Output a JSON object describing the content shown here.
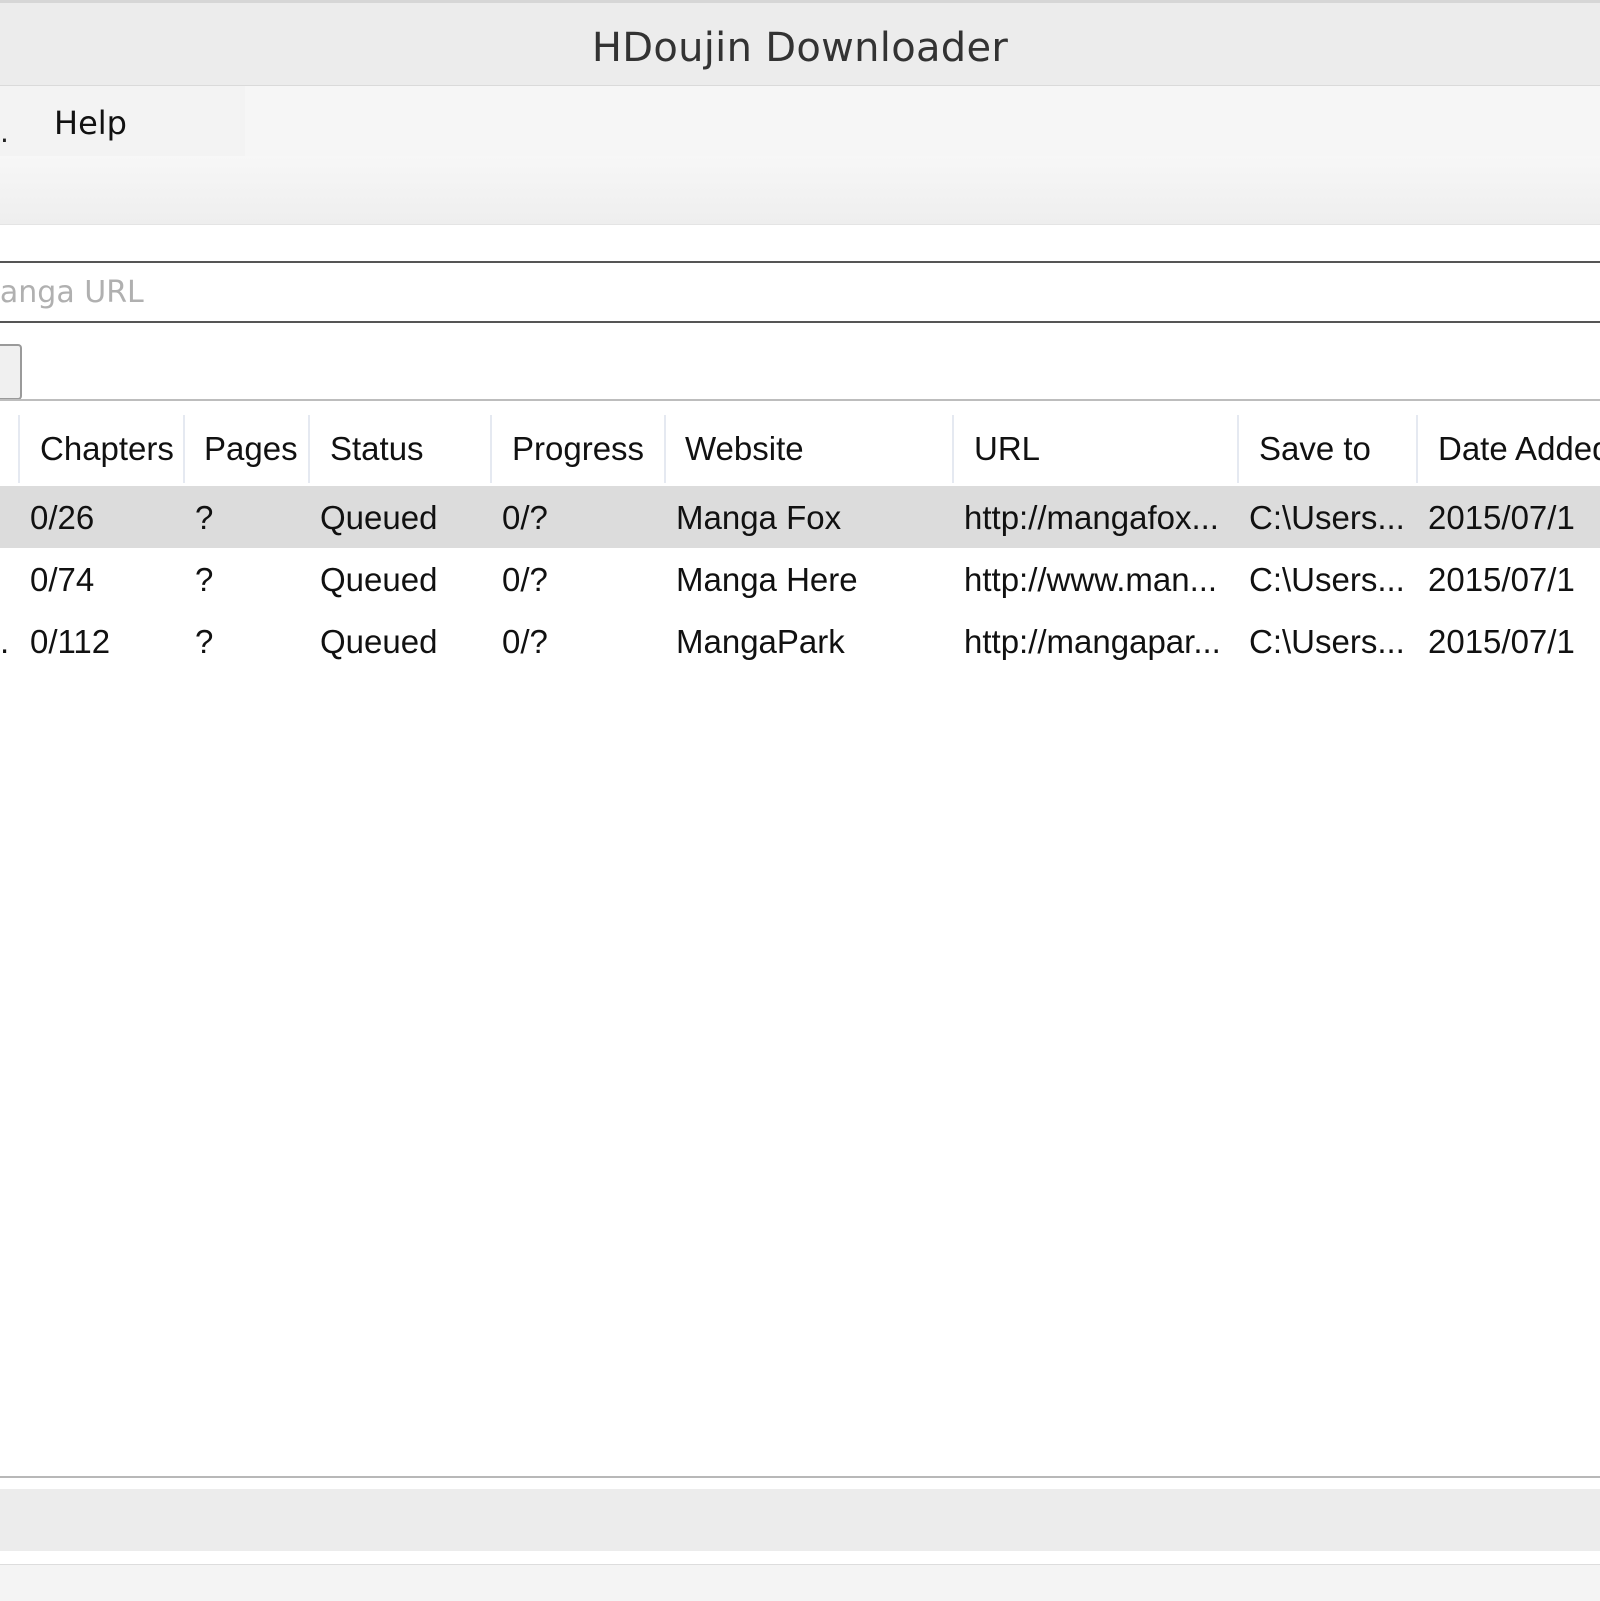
{
  "window": {
    "title": "HDoujin Downloader"
  },
  "menu": {
    "partial_item": ".",
    "help_label": "Help"
  },
  "url_field": {
    "value": "",
    "placeholder": "Manga URL"
  },
  "table": {
    "columns": [
      "Chapters",
      "Pages",
      "Status",
      "Progress",
      "Website",
      "URL",
      "Save to",
      "Date Added"
    ],
    "rows": [
      {
        "title_tail": "",
        "chapters": "0/26",
        "pages": "?",
        "status": "Queued",
        "progress": "0/?",
        "website": "Manga Fox",
        "url": "http://mangafox...",
        "save_to": "C:\\Users...",
        "date_added": "2015/07/1",
        "selected": true
      },
      {
        "title_tail": "",
        "chapters": "0/74",
        "pages": "?",
        "status": "Queued",
        "progress": "0/?",
        "website": "Manga Here",
        "url": "http://www.man...",
        "save_to": "C:\\Users...",
        "date_added": "2015/07/1",
        "selected": false
      },
      {
        "title_tail": ".",
        "chapters": "0/112",
        "pages": "?",
        "status": "Queued",
        "progress": "0/?",
        "website": "MangaPark",
        "url": "http://mangapar...",
        "save_to": "C:\\Users...",
        "date_added": "2015/07/1",
        "selected": false
      }
    ]
  }
}
